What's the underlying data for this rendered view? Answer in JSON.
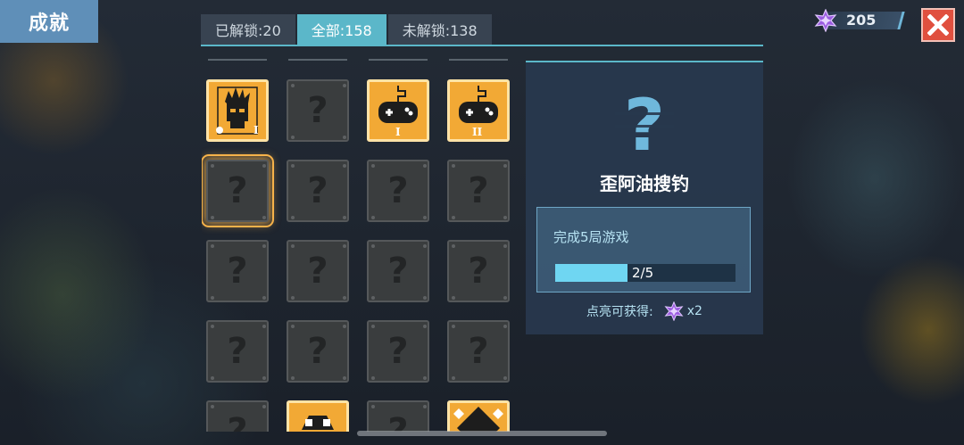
{
  "header": {
    "title": "成就"
  },
  "tabs": [
    {
      "label": "已解锁:20",
      "active": false
    },
    {
      "label": "全部:158",
      "active": true
    },
    {
      "label": "未解锁:138",
      "active": false
    }
  ],
  "currency": {
    "icon": "purple-star-gem-icon",
    "value": "205"
  },
  "close": {
    "icon": "close-icon"
  },
  "grid": [
    [
      "unlocked-character-I",
      "locked",
      "unlocked-gamepad-I",
      "unlocked-gamepad-II"
    ],
    [
      "locked-selected",
      "locked",
      "locked",
      "locked"
    ],
    [
      "locked",
      "locked",
      "locked",
      "locked"
    ],
    [
      "locked",
      "locked",
      "locked",
      "locked"
    ],
    [
      "locked",
      "unlocked-partial",
      "locked",
      "unlocked-partial"
    ]
  ],
  "detail": {
    "icon": "question-mark-icon",
    "name": "歪阿油搜钓",
    "task": "完成5局游戏",
    "progress_text": "2/5",
    "progress_value": 0.4,
    "reward_label": "点亮可获得:",
    "reward_amount": "x2"
  },
  "colors": {
    "accent": "#5bb7c9",
    "unlocked": "#f2a935",
    "close": "#e0503f"
  }
}
